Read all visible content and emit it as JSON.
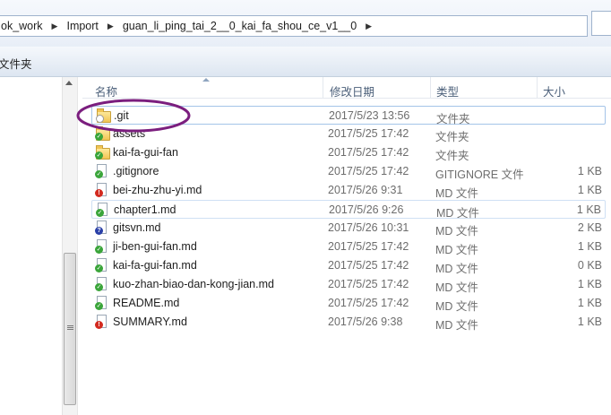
{
  "addressbar": {
    "crumbs": [
      "ok_work",
      "Import",
      "guan_li_ping_tai_2__0_kai_fa_shou_ce_v1__0"
    ]
  },
  "toolbar": {
    "new_folder_label": "文件夹"
  },
  "columns": {
    "name": "名称",
    "date": "修改日期",
    "type": "类型",
    "size": "大小"
  },
  "files": [
    {
      "name": ".git",
      "date": "2017/5/23 13:56",
      "type": "文件夹",
      "size": "",
      "icon": "folder-icon",
      "status": "ignored-icon"
    },
    {
      "name": "assets",
      "date": "2017/5/25 17:42",
      "type": "文件夹",
      "size": "",
      "icon": "folder-icon",
      "status": "ok-check-icon"
    },
    {
      "name": "kai-fa-gui-fan",
      "date": "2017/5/25 17:42",
      "type": "文件夹",
      "size": "",
      "icon": "folder-icon",
      "status": "ok-check-icon"
    },
    {
      "name": ".gitignore",
      "date": "2017/5/25 17:42",
      "type": "GITIGNORE 文件",
      "size": "1 KB",
      "icon": "file-icon",
      "status": "ok-check-icon"
    },
    {
      "name": "bei-zhu-zhu-yi.md",
      "date": "2017/5/26 9:31",
      "type": "MD 文件",
      "size": "1 KB",
      "icon": "file-icon",
      "status": "modified-icon"
    },
    {
      "name": "chapter1.md",
      "date": "2017/5/26 9:26",
      "type": "MD 文件",
      "size": "1 KB",
      "icon": "file-icon",
      "status": "ok-check-icon"
    },
    {
      "name": "gitsvn.md",
      "date": "2017/5/26 10:31",
      "type": "MD 文件",
      "size": "2 KB",
      "icon": "file-icon",
      "status": "unversioned-icon"
    },
    {
      "name": "ji-ben-gui-fan.md",
      "date": "2017/5/25 17:42",
      "type": "MD 文件",
      "size": "1 KB",
      "icon": "file-icon",
      "status": "ok-check-icon"
    },
    {
      "name": "kai-fa-gui-fan.md",
      "date": "2017/5/25 17:42",
      "type": "MD 文件",
      "size": "0 KB",
      "icon": "file-icon",
      "status": "ok-check-icon"
    },
    {
      "name": "kuo-zhan-biao-dan-kong-jian.md",
      "date": "2017/5/25 17:42",
      "type": "MD 文件",
      "size": "1 KB",
      "icon": "file-icon",
      "status": "ok-check-icon"
    },
    {
      "name": "README.md",
      "date": "2017/5/25 17:42",
      "type": "MD 文件",
      "size": "1 KB",
      "icon": "file-icon",
      "status": "ok-check-icon"
    },
    {
      "name": "SUMMARY.md",
      "date": "2017/5/26 9:38",
      "type": "MD 文件",
      "size": "1 KB",
      "icon": "file-icon",
      "status": "modified-icon"
    }
  ],
  "colors": {
    "annotation_circle": "#7b1e7e",
    "selection_border": "#a4c4e8"
  }
}
